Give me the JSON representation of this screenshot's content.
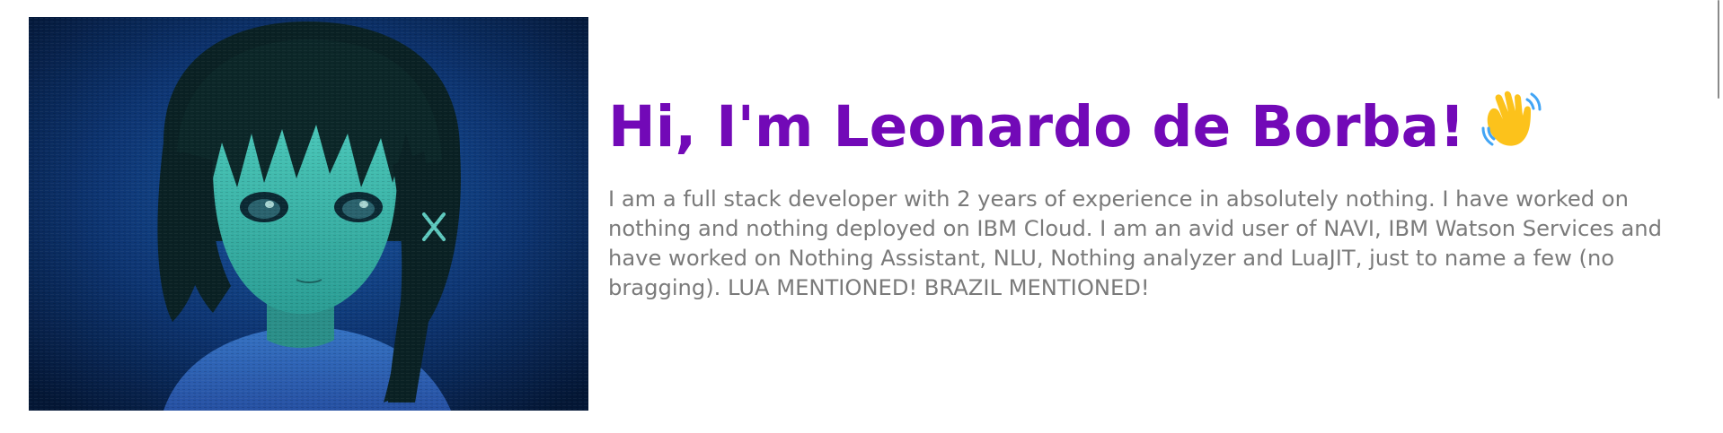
{
  "hero": {
    "image_alt": "Anime girl portrait with short dark hair on a dark blue glitchy background",
    "colors": {
      "background": "#0b2a5a",
      "skin": "#3fc9b8",
      "hair": "#0a1f1d",
      "accent": "#1f6bd1"
    }
  },
  "intro": {
    "headline": "Hi, I'm Leonardo de Borba!",
    "headline_icon": "waving-hand-icon",
    "bio": "I am a full stack developer with 2 years of experience in absolutely nothing. I have worked on nothing and nothing deployed on IBM Cloud. I am an avid user of NAVI, IBM Watson Services and have worked on Nothing Assistant, NLU, Nothing analyzer and LuaJIT, just to name a few (no bragging). LUA MENTIONED! BRAZIL MENTIONED!"
  },
  "theme": {
    "headline_color": "#7209b7",
    "text_color": "#7a7a7a"
  }
}
